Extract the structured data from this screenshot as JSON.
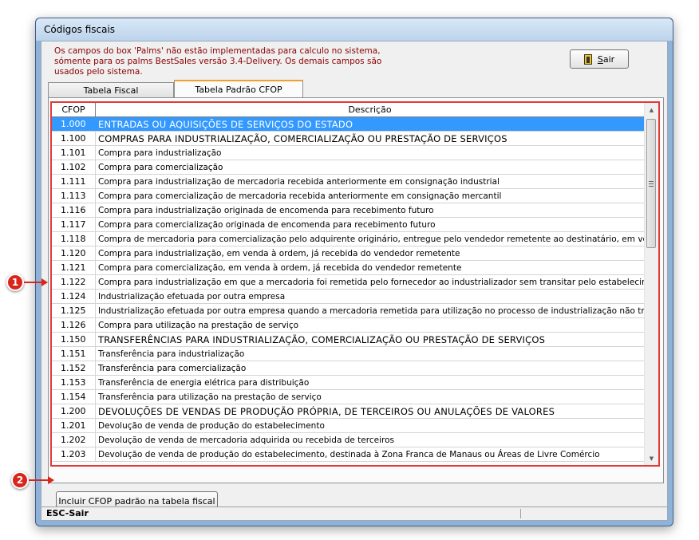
{
  "window": {
    "title": "Códigos fiscais"
  },
  "notice": {
    "line1": "Os campos do box 'Palms' não estão implementadas  para calculo no sistema,",
    "line2": "sómente para os palms BestSales versão 3.4-Delivery.  Os demais campos são",
    "line3": "usados pelo sistema."
  },
  "buttons": {
    "sair": "Sair",
    "incluir": "Incluir CFOP padrão na tabela fiscal"
  },
  "tabs": [
    {
      "label": "Tabela Fiscal"
    },
    {
      "label": "Tabela Padrão CFOP"
    }
  ],
  "active_tab": "Tabela Padrão CFOP",
  "table": {
    "headers": {
      "cfop": "CFOP",
      "descricao": "Descrição"
    },
    "rows": [
      {
        "code": "1.000",
        "desc": "ENTRADAS OU AQUISIÇÕES DE SERVIÇOS DO ESTADO"
      },
      {
        "code": "1.100",
        "desc": "COMPRAS PARA INDUSTRIALIZAÇÃO, COMERCIALIZAÇÃO OU PRESTAÇÃO DE SERVIÇOS"
      },
      {
        "code": "1.101",
        "desc": "Compra para industrialização"
      },
      {
        "code": "1.102",
        "desc": "Compra para comercialização"
      },
      {
        "code": "1.111",
        "desc": "Compra para industrialização de mercadoria recebida anteriormente em consignação industrial"
      },
      {
        "code": "1.113",
        "desc": "Compra para comercialização de mercadoria recebida anteriormente em consignação mercantil"
      },
      {
        "code": "1.116",
        "desc": "Compra para industrialização originada de encomenda para recebimento futuro"
      },
      {
        "code": "1.117",
        "desc": "Compra para comercialização originada de encomenda para recebimento futuro"
      },
      {
        "code": "1.118",
        "desc": "Compra de mercadoria para comercialização pelo adquirente originário, entregue pelo vendedor remetente ao destinatário, em venda à ordem"
      },
      {
        "code": "1.120",
        "desc": "Compra para industrialização, em venda à ordem, já recebida do vendedor remetente"
      },
      {
        "code": "1.121",
        "desc": "Compra para comercialização, em venda à ordem, já recebida do vendedor remetente"
      },
      {
        "code": "1.122",
        "desc": "Compra para industrialização em que a mercadoria foi remetida pelo fornecedor ao industrializador sem transitar pelo estabelecimento adquirente"
      },
      {
        "code": "1.124",
        "desc": "Industrialização efetuada por outra empresa"
      },
      {
        "code": "1.125",
        "desc": "Industrialização efetuada por outra empresa quando a mercadoria remetida para utilização no processo de industrialização não transitou pelo esta"
      },
      {
        "code": "1.126",
        "desc": "Compra para utilização na prestação de serviço"
      },
      {
        "code": "1.150",
        "desc": "TRANSFERÊNCIAS PARA INDUSTRIALIZAÇÃO, COMERCIALIZAÇÃO OU PRESTAÇÃO DE SERVIÇOS"
      },
      {
        "code": "1.151",
        "desc": "Transferência para industrialização"
      },
      {
        "code": "1.152",
        "desc": "Transferência para comercialização"
      },
      {
        "code": "1.153",
        "desc": "Transferência de energia elétrica para distribuição"
      },
      {
        "code": "1.154",
        "desc": "Transferência para utilização na prestação de serviço"
      },
      {
        "code": "1.200",
        "desc": "DEVOLUÇÕES DE VENDAS DE PRODUÇÃO PRÓPRIA, DE TERCEIROS OU ANULAÇÕES DE VALORES"
      },
      {
        "code": "1.201",
        "desc": "Devolução de venda de produção do estabelecimento"
      },
      {
        "code": "1.202",
        "desc": "Devolução de venda de mercadoria adquirida ou recebida de terceiros"
      },
      {
        "code": "1.203",
        "desc": "Devolução de venda de produção do estabelecimento, destinada à Zona Franca de Manaus ou Áreas de Livre Comércio"
      }
    ]
  },
  "selected_row": "1.000",
  "callouts": {
    "one": "1",
    "two": "2"
  },
  "status": {
    "text": "ESC-Sair"
  },
  "colors": {
    "selection": "#3399ff",
    "highlight_border": "#e23a3a",
    "notice_text": "#8b0000",
    "callout": "#d9261c"
  }
}
